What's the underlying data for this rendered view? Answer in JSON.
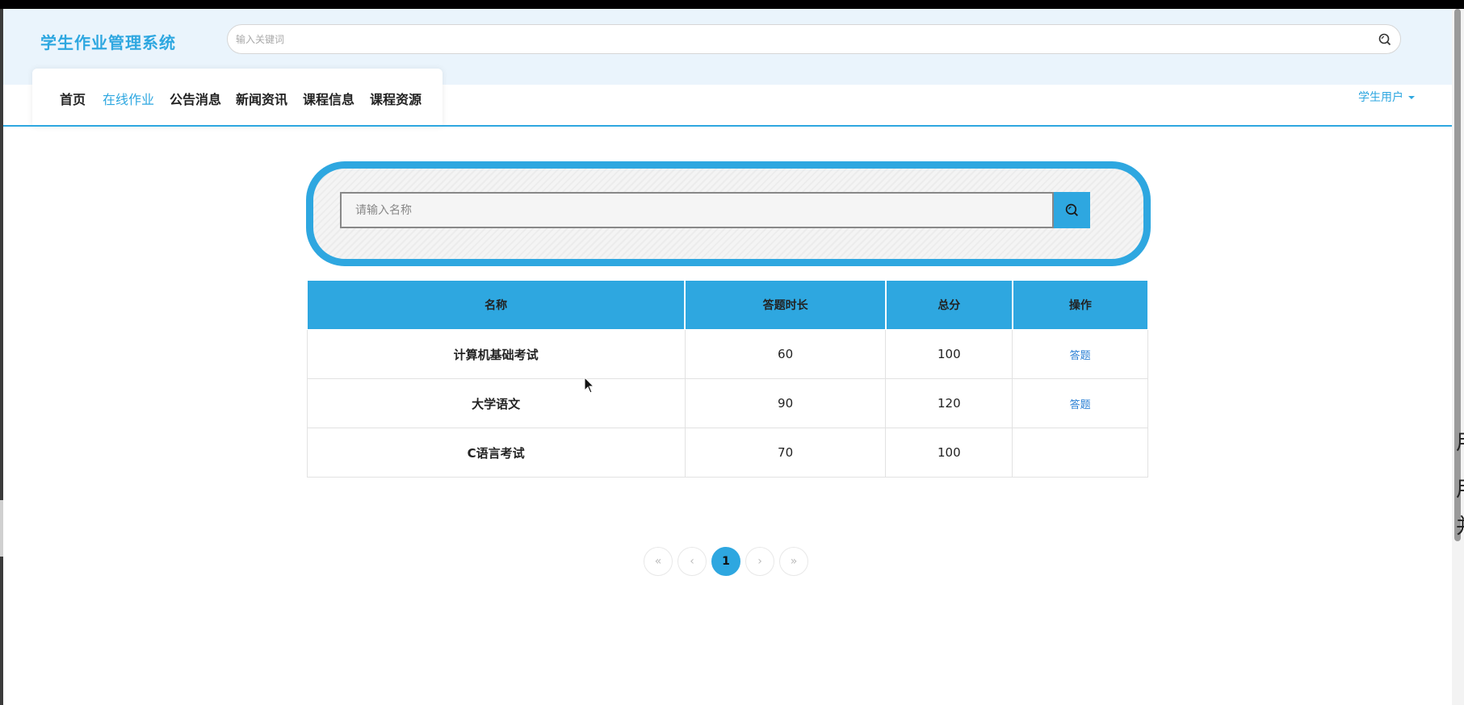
{
  "site": {
    "title": "学生作业管理系统"
  },
  "top_search": {
    "placeholder": "输入关键词",
    "icon": "search-icon"
  },
  "nav": {
    "items": [
      {
        "label": "首页",
        "active": false
      },
      {
        "label": "在线作业",
        "active": true
      },
      {
        "label": "公告消息",
        "active": false
      },
      {
        "label": "新闻资讯",
        "active": false
      },
      {
        "label": "课程信息",
        "active": false
      },
      {
        "label": "课程资源",
        "active": false
      }
    ]
  },
  "user_menu": {
    "label": "学生用户"
  },
  "search": {
    "placeholder": "请输入名称",
    "icon": "search-icon"
  },
  "table": {
    "headers": [
      "名称",
      "答题时长",
      "总分",
      "操作"
    ],
    "rows": [
      {
        "name": "计算机基础考试",
        "duration": "60",
        "score": "100",
        "action": "答题"
      },
      {
        "name": "大学语文",
        "duration": "90",
        "score": "120",
        "action": "答题"
      },
      {
        "name": "C语言考试",
        "duration": "70",
        "score": "100",
        "action": ""
      }
    ]
  },
  "pagination": {
    "first": "«",
    "prev": "‹",
    "current": "1",
    "next": "›",
    "last": "»"
  },
  "side_text": [
    "用",
    "用",
    "并"
  ],
  "colors": {
    "accent": "#2ea7e0",
    "header_bg": "#eaf4fc",
    "link": "#2a7fd4"
  }
}
